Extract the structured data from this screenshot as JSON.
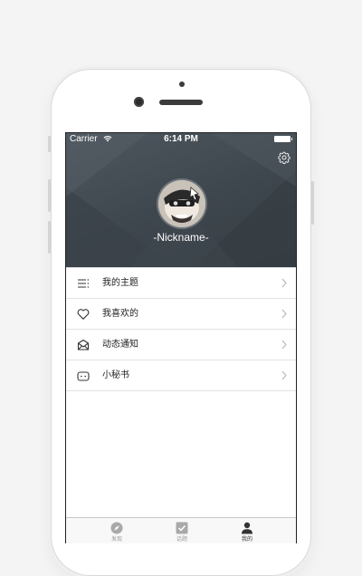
{
  "status_bar": {
    "carrier": "Carrier",
    "time": "6:14 PM"
  },
  "profile": {
    "nickname": "-Nickname-"
  },
  "icons": {
    "settings": "gear-icon",
    "avatar": "avatar-image"
  },
  "menu": {
    "items": [
      {
        "label": "我的主题",
        "icon": "list-icon"
      },
      {
        "label": "我喜欢的",
        "icon": "heart-icon"
      },
      {
        "label": "动态通知",
        "icon": "envelope-icon"
      },
      {
        "label": "小秘书",
        "icon": "chat-bot-icon"
      }
    ]
  },
  "tab_bar": {
    "tabs": [
      {
        "label": "发现",
        "icon": "compass-icon",
        "active": false
      },
      {
        "label": "话题",
        "icon": "checkbox-icon",
        "active": false
      },
      {
        "label": "我的",
        "icon": "person-icon",
        "active": true
      }
    ]
  },
  "colors": {
    "header_bg": "#434b52",
    "text": "#222222",
    "divider": "#e2e2e2",
    "tab_inactive": "#9b9b9b",
    "tab_active": "#333333"
  }
}
